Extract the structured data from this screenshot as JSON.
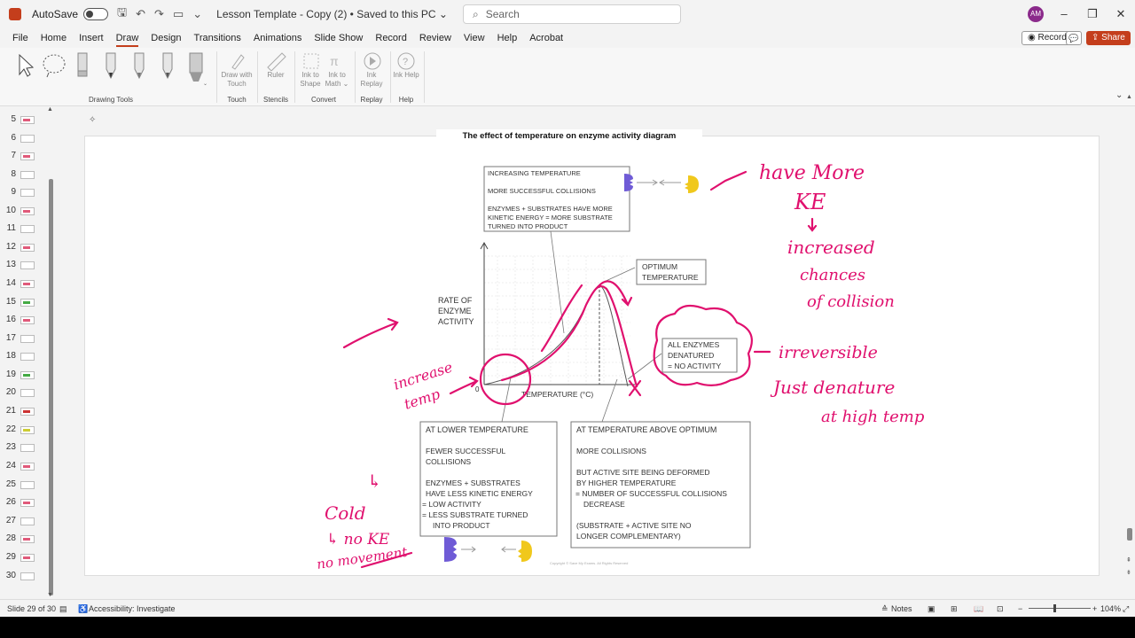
{
  "titlebar": {
    "autosave_label": "AutoSave",
    "document_title": "Lesson Template - Copy (2) • Saved to this PC ⌄",
    "search_placeholder": "Search",
    "avatar_initials": "AM"
  },
  "menu": {
    "items": [
      "File",
      "Home",
      "Insert",
      "Draw",
      "Design",
      "Transitions",
      "Animations",
      "Slide Show",
      "Record",
      "Review",
      "View",
      "Help",
      "Acrobat"
    ],
    "active": "Draw",
    "record_label": "Record",
    "share_label": "Share"
  },
  "ribbon": {
    "drawing_tools_label": "Drawing Tools",
    "draw_with_touch_label": "Draw with Touch",
    "touch_label": "Touch",
    "ruler_label": "Ruler",
    "stencils_label": "Stencils",
    "ink_to_shape_label": "Ink to Shape",
    "ink_to_math_label": "Ink to Math ⌄",
    "convert_label": "Convert",
    "ink_replay_label": "Ink Replay",
    "replay_label": "Replay",
    "ink_help_label": "Ink Help",
    "help_label": "Help"
  },
  "thumbnails": [
    "5",
    "6",
    "7",
    "8",
    "9",
    "10",
    "11",
    "12",
    "13",
    "14",
    "15",
    "16",
    "17",
    "18",
    "19",
    "20",
    "21",
    "22",
    "23",
    "24",
    "25",
    "26",
    "27",
    "28",
    "29",
    "30"
  ],
  "slide": {
    "title": "The effect of temperature on enzyme activity diagram",
    "box_increasing": {
      "heading": "INCREASING TEMPERATURE",
      "line1": "MORE SUCCESSFUL COLLISIONS",
      "line2": "ENZYMES + SUBSTRATES HAVE MORE",
      "line3": "KINETIC ENERGY = MORE SUBSTRATE",
      "line4": "TURNED INTO PRODUCT"
    },
    "box_optimum": {
      "line1": "OPTIMUM",
      "line2": "TEMPERATURE"
    },
    "box_denatured": {
      "line1": "ALL ENZYMES",
      "line2": "DENATURED",
      "line3": "= NO ACTIVITY"
    },
    "y_axis_label": {
      "line1": "RATE OF",
      "line2": "ENZYME",
      "line3": "ACTIVITY"
    },
    "x_axis_label": "TEMPERATURE (°C)",
    "origin_label": "0",
    "box_lower": {
      "heading": "AT LOWER TEMPERATURE",
      "l1": "FEWER SUCCESSFUL",
      "l2": "COLLISIONS",
      "l3": "ENZYMES + SUBSTRATES",
      "l4": "HAVE LESS KINETIC ENERGY",
      "l5": "= LOW ACTIVITY",
      "l6": "= LESS SUBSTRATE TURNED",
      "l7": "INTO PRODUCT"
    },
    "box_above": {
      "heading": "AT TEMPERATURE ABOVE OPTIMUM",
      "l1": "MORE COLLISIONS",
      "l2": "BUT ACTIVE SITE BEING DEFORMED",
      "l3": "BY HIGHER TEMPERATURE",
      "l4": "= NUMBER OF SUCCESSFUL COLLISIONS",
      "l5": "DECREASE",
      "l6": "(SUBSTRATE + ACTIVE SITE NO",
      "l7": "LONGER COMPLEMENTARY)"
    },
    "copyright": "Copyright © Save My Exams. All Rights Reserved",
    "ink_colour": "#e0106e",
    "annotations": {
      "have_more": "have More",
      "ke": "KE",
      "increased": "increased",
      "chances": "chances",
      "of_collision": "of collision",
      "irreversible": "irreversible",
      "just_denature": "Just denature",
      "at_high_temp": "at high temp",
      "increase": "increase",
      "temp": "temp",
      "cold": "Cold",
      "no_ke": "↳ no KE",
      "no_movement": "no movement",
      "arrow_l": "↳"
    }
  },
  "status": {
    "slide_info": "Slide 29 of 30",
    "accessibility": "Accessibility: Investigate",
    "notes": "Notes",
    "zoom": "104%"
  }
}
